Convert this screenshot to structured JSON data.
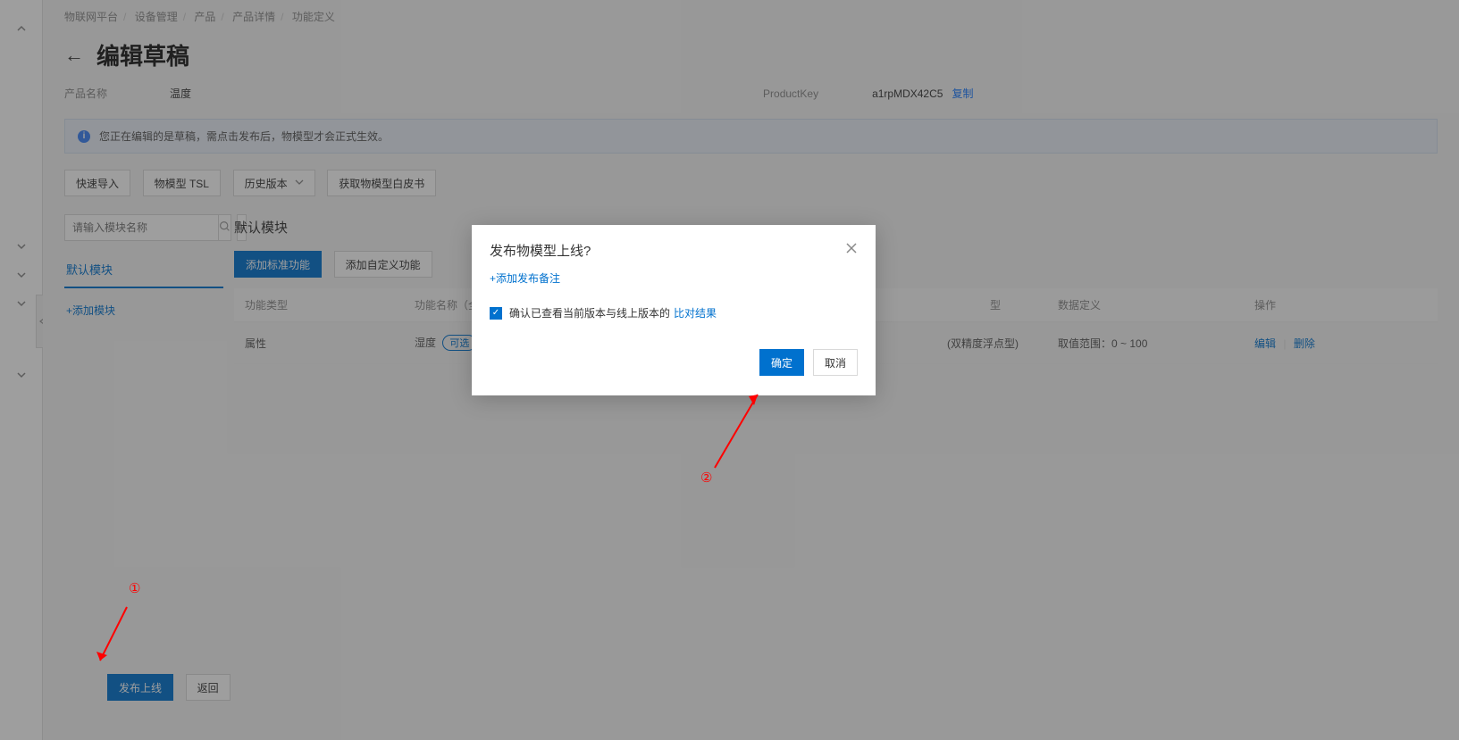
{
  "breadcrumb": {
    "items": [
      "物联网平台",
      "设备管理",
      "产品",
      "产品详情"
    ],
    "current": "功能定义"
  },
  "page": {
    "title": "编辑草稿",
    "product_name_label": "产品名称",
    "product_name_value": "温度",
    "product_key_label": "ProductKey",
    "product_key_value": "a1rpMDX42C5",
    "copy": "复制"
  },
  "banner": {
    "text": "您正在编辑的是草稿，需点击发布后，物模型才会正式生效。"
  },
  "toolbar": {
    "quick_import": "快速导入",
    "tsl": "物模型 TSL",
    "history": "历史版本",
    "whitepaper": "获取物模型白皮书"
  },
  "sidebar": {
    "search_placeholder": "请输入模块名称",
    "default_module": "默认模块",
    "add_module": "+添加模块"
  },
  "main": {
    "section_title": "默认模块",
    "add_standard": "添加标准功能",
    "add_custom": "添加自定义功能",
    "headers": {
      "type": "功能类型",
      "name": "功能名称（全",
      "datatype": "型",
      "definition": "数据定义",
      "action": "操作"
    },
    "row": {
      "type": "属性",
      "name": "湿度",
      "optional_tag": "可选",
      "datatype": "(双精度浮点型)",
      "definition": "取值范围：0 ~ 100",
      "edit": "编辑",
      "delete": "删除"
    }
  },
  "footer": {
    "publish": "发布上线",
    "back": "返回"
  },
  "modal": {
    "title": "发布物模型上线?",
    "add_note": "+添加发布备注",
    "check_text": "确认已查看当前版本与线上版本的",
    "compare_link": "比对结果",
    "ok": "确定",
    "cancel": "取消"
  },
  "annotations": {
    "one": "①",
    "two": "②"
  }
}
